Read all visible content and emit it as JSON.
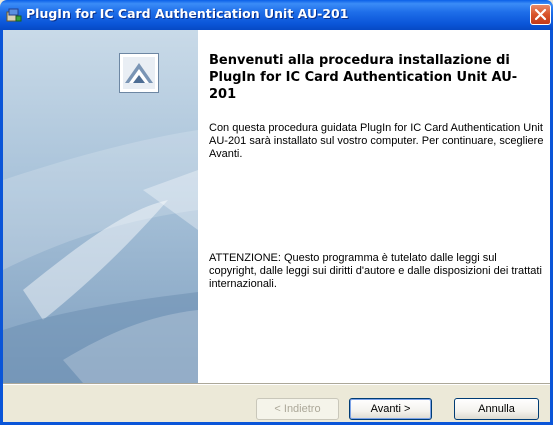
{
  "window": {
    "title": "PlugIn for IC Card Authentication Unit AU-201",
    "icon": "installer-icon",
    "close_icon": "close-icon"
  },
  "content": {
    "heading": "Benvenuti alla procedura installazione di PlugIn for IC Card Authentication Unit AU-201",
    "paragraph1": "Con questa procedura guidata PlugIn for IC Card Authentication Unit AU-201 sarà installato sul vostro computer. Per continuare, scegliere Avanti.",
    "paragraph2": "ATTENZIONE: Questo programma è tutelato dalle leggi sul copyright, dalle leggi sui diritti d'autore e dalle disposizioni dei trattati internazionali."
  },
  "buttons": {
    "back": {
      "label": "< Indietro",
      "enabled": false
    },
    "next": {
      "label": "Avanti >",
      "enabled": true
    },
    "cancel": {
      "label": "Annulla",
      "enabled": true
    }
  },
  "colors": {
    "titlebar": "#0a55d8",
    "close": "#d9542a",
    "side_panel": "#a8c2d9",
    "dialog_bg": "#ece9d8"
  }
}
